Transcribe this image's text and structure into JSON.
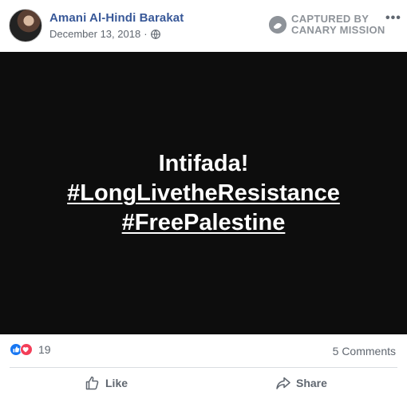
{
  "post": {
    "author": "Amani Al-Hindi Barakat",
    "date": "December 13, 2018",
    "date_separator": "·",
    "privacy_icon": "globe-icon",
    "more_label": "•••"
  },
  "watermark": {
    "line1": "CAPTURED BY",
    "line2": "CANARY MISSION"
  },
  "image_text": {
    "line1": "Intifada!",
    "line2": "#LongLivetheResistance",
    "line3": "#FreePalestine"
  },
  "stats": {
    "reaction_icons": [
      "like-icon",
      "love-icon"
    ],
    "reaction_count": "19",
    "comments": "5 Comments"
  },
  "actions": {
    "like_label": "Like",
    "share_label": "Share"
  },
  "colors": {
    "author": "#385898",
    "image_bg": "#0d0d0d",
    "like": "#1877f2",
    "love": "#f33e58",
    "meta": "#606770"
  }
}
